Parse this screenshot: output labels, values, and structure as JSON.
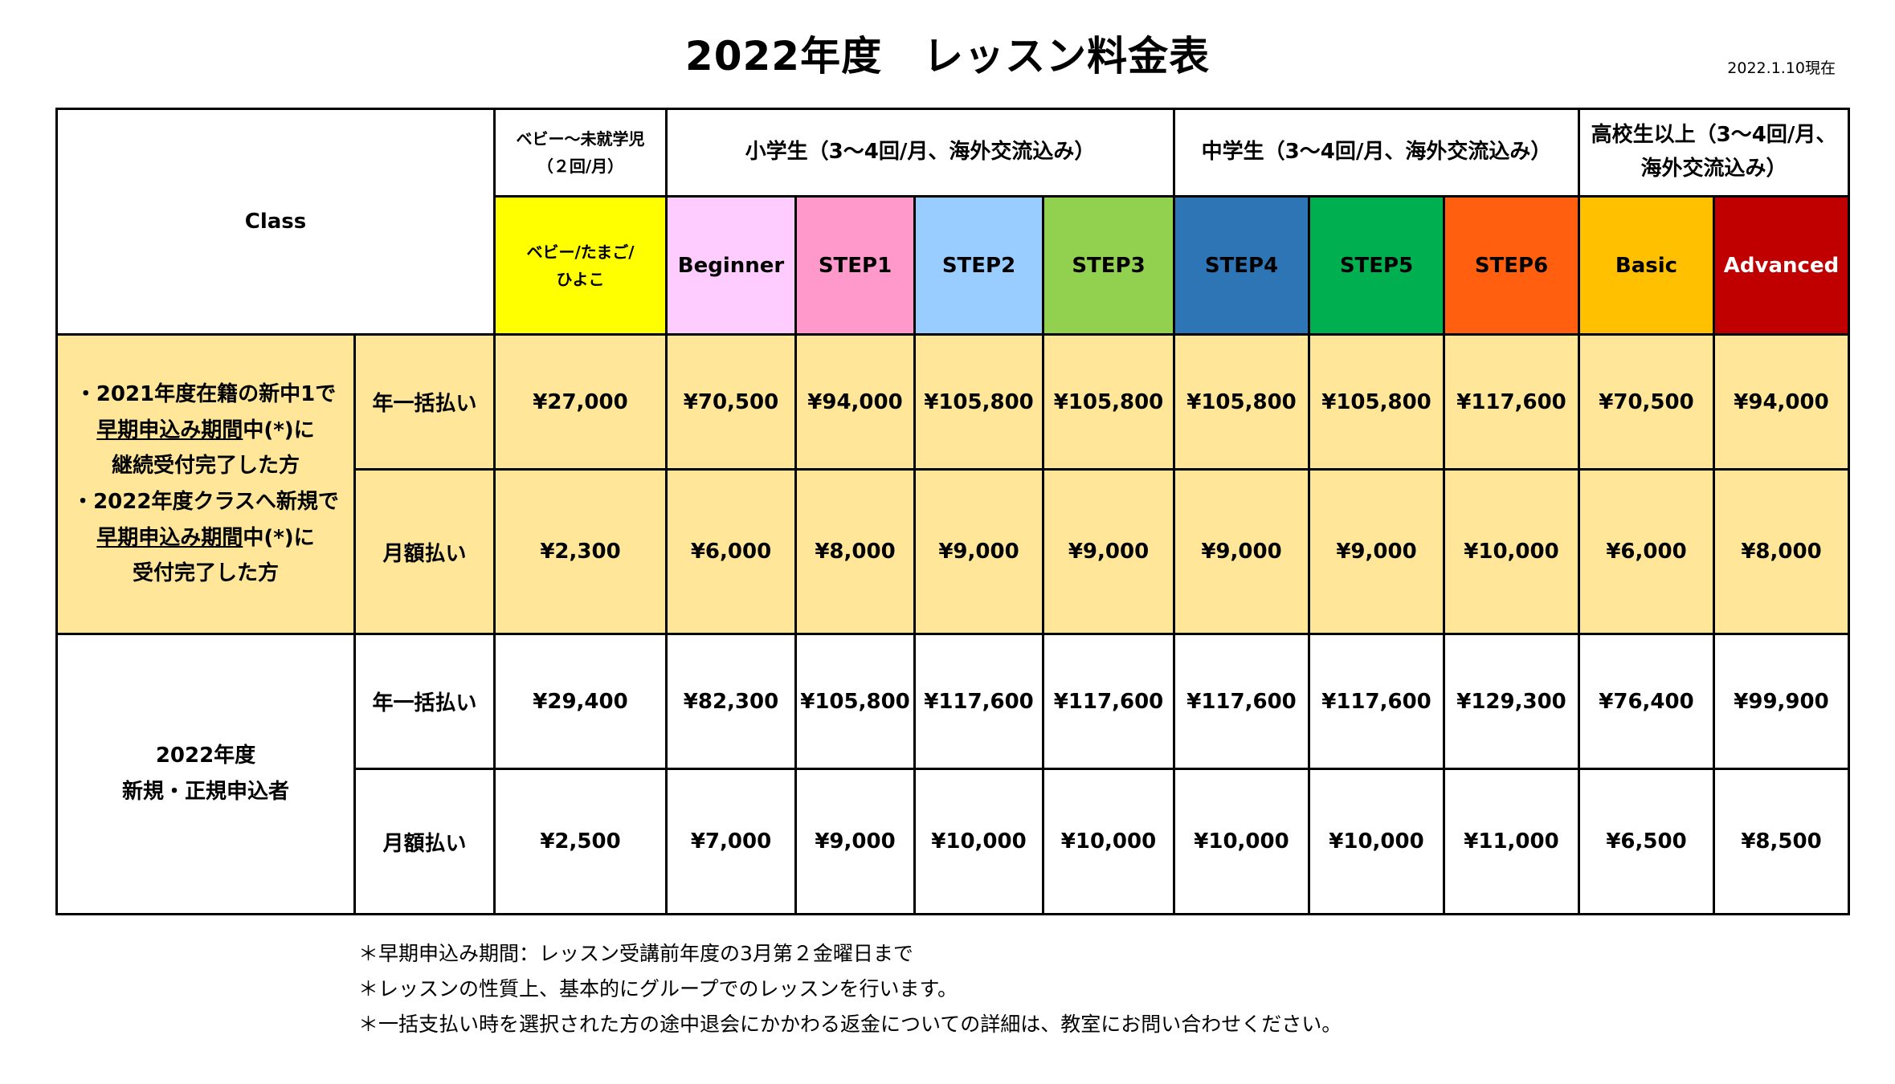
{
  "title": "2022年度　レッスン料金表",
  "date": "2022.1.10現在",
  "table": {
    "class_label": "Class",
    "groups": [
      {
        "line1": "ベビー～未就学児",
        "line2": "（２回/月）"
      },
      {
        "label": "小学生（3～4回/月、海外交流込み）"
      },
      {
        "label": "中学生（3～4回/月、海外交流込み）"
      },
      {
        "line1": "高校生以上（3～4回/月、",
        "line2": "海外交流込み）"
      }
    ],
    "levels": [
      {
        "line1": "ベビー/たまご/",
        "line2": "ひよこ",
        "bg": "#ffff00",
        "fg": "#000000"
      },
      {
        "label": "Beginner",
        "bg": "#ffccff",
        "fg": "#000000"
      },
      {
        "label": "STEP1",
        "bg": "#ff99cc",
        "fg": "#000000"
      },
      {
        "label": "STEP2",
        "bg": "#99ccff",
        "fg": "#000000"
      },
      {
        "label": "STEP3",
        "bg": "#92d050",
        "fg": "#000000"
      },
      {
        "label": "STEP4",
        "bg": "#2e75b6",
        "fg": "#000000"
      },
      {
        "label": "STEP5",
        "bg": "#00b050",
        "fg": "#000000"
      },
      {
        "label": "STEP6",
        "bg": "#ff5f0f",
        "fg": "#000000"
      },
      {
        "label": "Basic",
        "bg": "#ffc000",
        "fg": "#000000"
      },
      {
        "label": "Advanced",
        "bg": "#c00000",
        "fg": "#ffffff"
      }
    ],
    "sections": [
      {
        "highlight_color": "#ffe699",
        "desc": [
          {
            "pre": "・2021年度在籍の新中1で",
            "u": "",
            "post": ""
          },
          {
            "pre": "",
            "u": "早期申込み期間",
            "post": "中(*)に"
          },
          {
            "pre": "継続受付完了した方",
            "u": "",
            "post": ""
          },
          {
            "pre": "・2022年度クラスへ新規で",
            "u": "",
            "post": ""
          },
          {
            "pre": "",
            "u": "早期申込み期間",
            "post": "中(*)に"
          },
          {
            "pre": "受付完了した方",
            "u": "",
            "post": ""
          }
        ],
        "rows": [
          {
            "payment": "年一括払い",
            "prices": [
              "¥27,000",
              "¥70,500",
              "¥94,000",
              "¥105,800",
              "¥105,800",
              "¥105,800",
              "¥105,800",
              "¥117,600",
              "¥70,500",
              "¥94,000"
            ]
          },
          {
            "payment": "月額払い",
            "prices": [
              "¥2,300",
              "¥6,000",
              "¥8,000",
              "¥9,000",
              "¥9,000",
              "¥9,000",
              "¥9,000",
              "¥10,000",
              "¥6,000",
              "¥8,000"
            ]
          }
        ]
      },
      {
        "highlight_color": "#ffffff",
        "desc": [
          {
            "pre": "2022年度",
            "u": "",
            "post": ""
          },
          {
            "pre": "新規・正規申込者",
            "u": "",
            "post": ""
          }
        ],
        "rows": [
          {
            "payment": "年一括払い",
            "prices": [
              "¥29,400",
              "¥82,300",
              "¥105,800",
              "¥117,600",
              "¥117,600",
              "¥117,600",
              "¥117,600",
              "¥129,300",
              "¥76,400",
              "¥99,900"
            ]
          },
          {
            "payment": "月額払い",
            "prices": [
              "¥2,500",
              "¥7,000",
              "¥9,000",
              "¥10,000",
              "¥10,000",
              "¥10,000",
              "¥10,000",
              "¥11,000",
              "¥6,500",
              "¥8,500"
            ]
          }
        ]
      }
    ]
  },
  "notes": [
    "＊早期申込み期間：レッスン受講前年度の3月第２金曜日まで",
    "＊レッスンの性質上、基本的にグループでのレッスンを行います。",
    "＊一括支払い時を選択された方の途中退会にかかわる返金についての詳細は、教室にお問い合わせください。"
  ]
}
